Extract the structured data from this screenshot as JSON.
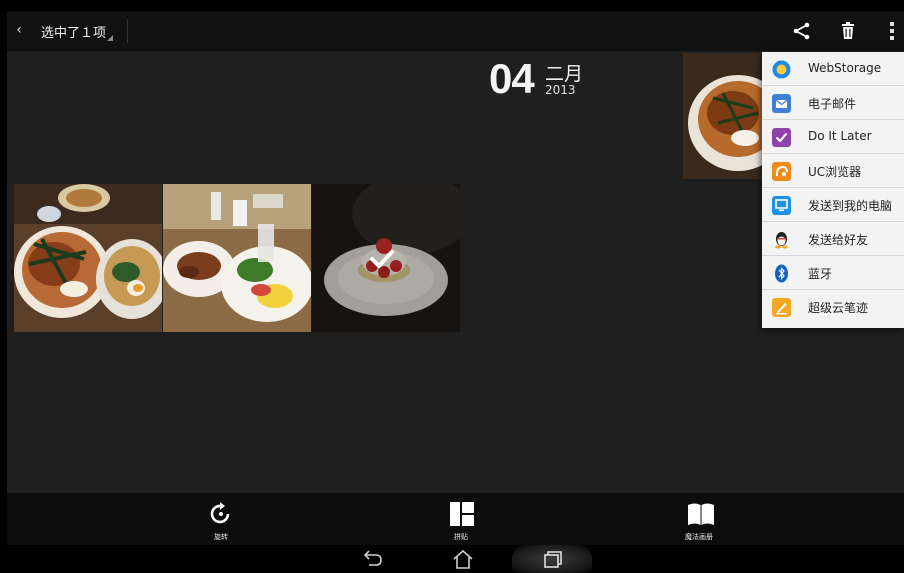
{
  "action_bar": {
    "selection_title": "选中了１项",
    "icons": [
      "back-icon",
      "share-icon",
      "trash-icon",
      "overflow-menu-icon"
    ]
  },
  "date_header": {
    "day": "04",
    "month": "二月",
    "year": "2013"
  },
  "share_menu": {
    "items": [
      {
        "label": "WebStorage",
        "icon": "webstorage-icon",
        "color": "#1e88e5"
      },
      {
        "label": "电子邮件",
        "icon": "email-icon",
        "color": "#3f7fd6"
      },
      {
        "label": "Do It Later",
        "icon": "do-it-later-icon",
        "color": "#8e44ad"
      },
      {
        "label": "UC浏览器",
        "icon": "uc-browser-icon",
        "color": "#f08a1a"
      },
      {
        "label": "发送到我的电脑",
        "icon": "send-to-pc-icon",
        "color": "#1e90e6"
      },
      {
        "label": "发送给好友",
        "icon": "qq-icon",
        "color": "#222222"
      },
      {
        "label": "蓝牙",
        "icon": "bluetooth-icon",
        "color": "#1565c0"
      },
      {
        "label": "超级云笔迹",
        "icon": "super-note-icon",
        "color": "#f5a623"
      }
    ]
  },
  "bottom_bar": {
    "rotate_label": "旋转",
    "collage_label": "拼贴",
    "magic_album_label": "魔法画册"
  },
  "system_nav": {
    "icons": [
      "back-nav-icon",
      "home-nav-icon",
      "recent-apps-icon"
    ]
  },
  "colors": {
    "background": "#1f1f1f",
    "action_bar": "#111111",
    "menu_background": "#f3f3f3"
  }
}
